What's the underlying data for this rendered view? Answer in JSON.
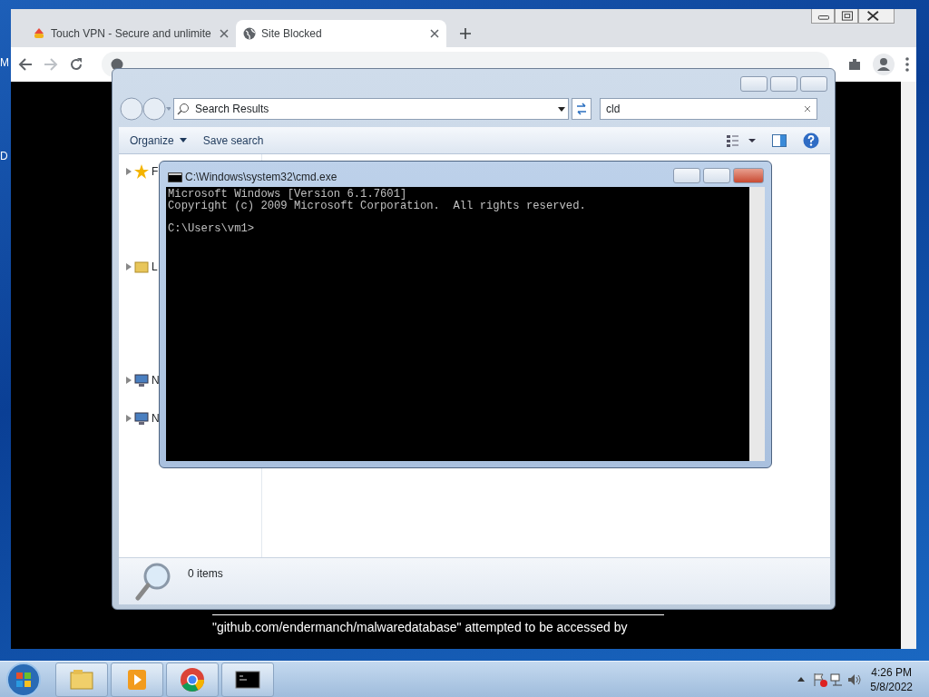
{
  "desktop": {
    "icon_labels": [
      "M",
      "D"
    ]
  },
  "browser": {
    "tabs": [
      {
        "title": "Touch VPN - Secure and unlimite",
        "selected": false
      },
      {
        "title": "Site Blocked",
        "selected": true
      }
    ],
    "message": "\"github.com/endermanch/malwaredatabase\" attempted to be accessed by"
  },
  "explorer": {
    "breadcrumb": "Search Results",
    "search": "cld",
    "toolbar": [
      {
        "label": "Organize",
        "dropdown": true
      },
      {
        "label": "Save search",
        "dropdown": false
      }
    ],
    "nav": [
      {
        "label": "F"
      },
      {
        "label": "L"
      },
      {
        "label": "N"
      },
      {
        "label": "N"
      }
    ],
    "status": "0 items"
  },
  "cmd": {
    "title": "C:\\Windows\\system32\\cmd.exe",
    "lines": [
      {
        "kind": "output",
        "text": "Microsoft Windows [Version 6.1.7601]"
      },
      {
        "kind": "output",
        "text": "Copyright (c) 2009 Microsoft Corporation.  All rights reserved."
      },
      {
        "kind": "prompt",
        "text": "C:\\Users\\vm1>"
      }
    ]
  },
  "taskbar": {
    "time": "4:26 PM",
    "date": "5/8/2022"
  }
}
